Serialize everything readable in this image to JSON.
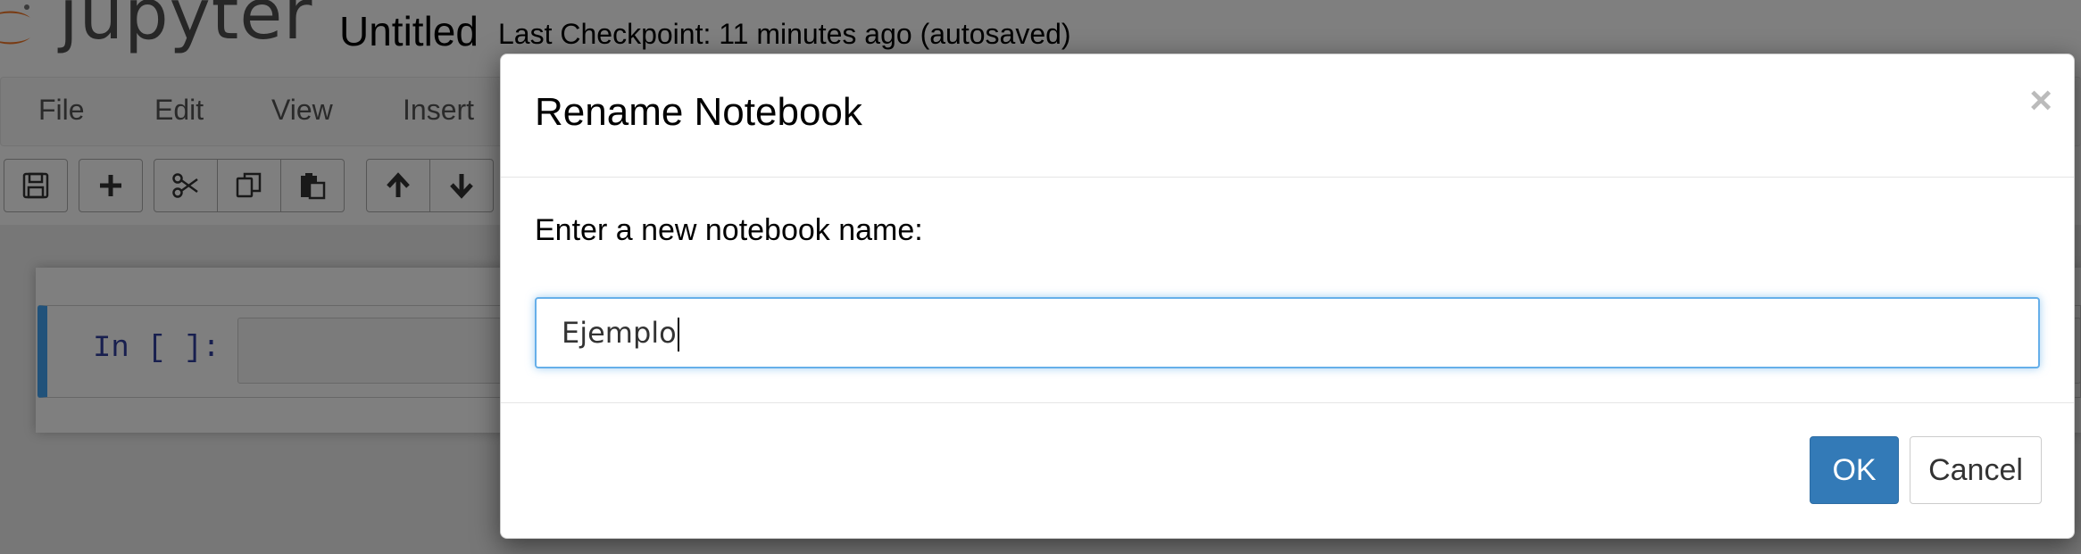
{
  "header": {
    "logo_text": "jupyter",
    "notebook_name": "Untitled",
    "checkpoint": "Last Checkpoint: 11 minutes ago (autosaved)"
  },
  "menu": {
    "items": [
      "File",
      "Edit",
      "View",
      "Insert"
    ]
  },
  "toolbar": {
    "groups": [
      [
        "save-icon"
      ],
      [
        "plus-icon"
      ],
      [
        "scissors-icon",
        "copy-icon",
        "paste-icon"
      ],
      [
        "arrow-up-icon",
        "arrow-down-icon"
      ]
    ]
  },
  "cell": {
    "prompt": "In [ ]:"
  },
  "dialog": {
    "title": "Rename Notebook",
    "close_label": "×",
    "prompt_label": "Enter a new notebook name:",
    "input_value": "Ejemplo",
    "ok_label": "OK",
    "cancel_label": "Cancel"
  },
  "colors": {
    "accent": "#337ab7",
    "cell_selected_border": "#42A5F5",
    "prompt_color": "#303F9F",
    "logo_orange": "#F37726"
  }
}
